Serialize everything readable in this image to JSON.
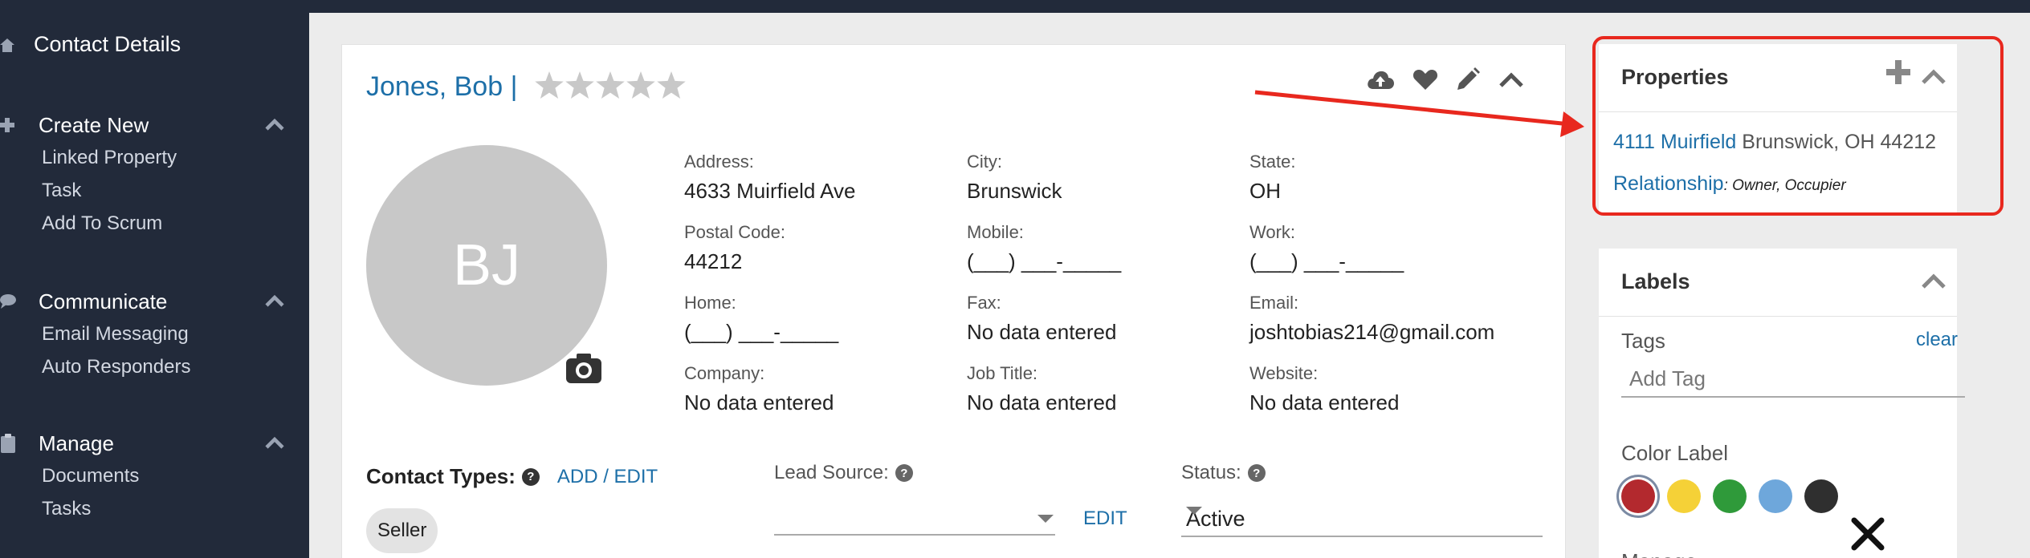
{
  "sidebar": {
    "top_label": "Contact Details",
    "sections": [
      {
        "title": "Create New",
        "items": [
          "Linked Property",
          "Task",
          "Add To Scrum"
        ]
      },
      {
        "title": "Communicate",
        "items": [
          "Email Messaging",
          "Auto Responders"
        ]
      },
      {
        "title": "Manage",
        "items": [
          "Documents",
          "Tasks"
        ]
      }
    ]
  },
  "contact": {
    "name": "Jones, Bob |",
    "initials": "BJ",
    "rating": 0,
    "fields": {
      "address_label": "Address:",
      "address": "4633 Muirfield Ave",
      "city_label": "City:",
      "city": "Brunswick",
      "state_label": "State:",
      "state": "OH",
      "postal_label": "Postal Code:",
      "postal": "44212",
      "mobile_label": "Mobile:",
      "mobile": "(___) ___-_____",
      "work_label": "Work:",
      "work": "(___) ___-_____",
      "home_label": "Home:",
      "home": "(___) ___-_____",
      "fax_label": "Fax:",
      "fax": "No data entered",
      "email_label": "Email:",
      "email": "joshtobias214@gmail.com",
      "company_label": "Company:",
      "company": "No data entered",
      "jobtitle_label": "Job Title:",
      "jobtitle": "No data entered",
      "website_label": "Website:",
      "website": "No data entered"
    },
    "contact_types_label": "Contact Types:",
    "add_edit": "ADD / EDIT",
    "contact_type_chip": "Seller",
    "lead_source_label": "Lead Source:",
    "lead_source_value": "",
    "lead_edit": "EDIT",
    "status_label": "Status:",
    "status_value": "Active"
  },
  "properties": {
    "title": "Properties",
    "address_link": "4111 Muirfield",
    "address_rest": " Brunswick, OH 44212",
    "relationship_label": "Relationship",
    "relationship_value": ": Owner, Occupier"
  },
  "labels": {
    "title": "Labels",
    "tags_label": "Tags",
    "clear": "clear",
    "tag_placeholder": "Add Tag",
    "color_label": "Color Label",
    "colors": [
      "#b3292e",
      "#f5d137",
      "#2f9a3a",
      "#6ea7db",
      "#2f2f2f"
    ],
    "selected_color": 0,
    "manage_partial": "Manage"
  },
  "accent": {
    "link": "#1d6fa8",
    "annotation": "#e8281e",
    "sidebar_bg": "#222a3a"
  }
}
